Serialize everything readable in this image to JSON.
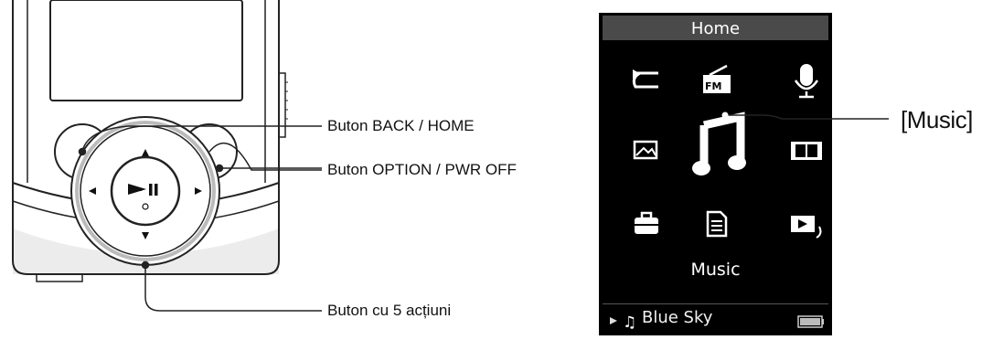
{
  "callouts": {
    "back_home": "Buton BACK / HOME",
    "option_pwr": "Buton OPTION / PWR OFF",
    "five_way": "Buton cu 5 acțiuni"
  },
  "screen": {
    "title": "Home",
    "selected_label": "Music",
    "now_playing_track": "Blue Sky",
    "icons": [
      "repeat-arrow-icon",
      "fm-radio-icon",
      "microphone-icon",
      "picture-icon",
      "music-note-icon",
      "film-icon",
      "settings-toolbox-icon",
      "document-icon",
      "video-return-icon"
    ]
  },
  "screen_callout": "[Music]",
  "colors": {
    "screen_bg": "#000000",
    "title_bar": "#4a4a4a",
    "icon": "#ffffff",
    "device_outline": "#222222",
    "device_panel": "#ededed"
  }
}
